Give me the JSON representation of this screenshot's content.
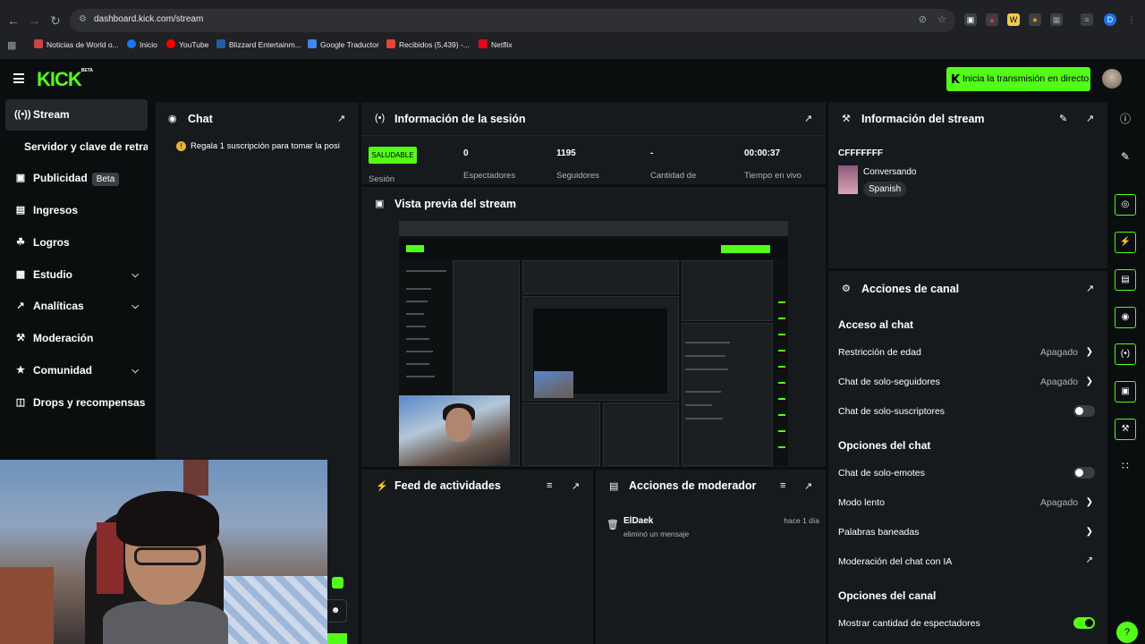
{
  "browser": {
    "url": "dashboard.kick.com/stream",
    "bookmarks": [
      "Noticias de World o...",
      "Inicio",
      "YouTube",
      "Blizzard Entertainm...",
      "Google Traductor",
      "Recibidos (5,439) -...",
      "Netflix"
    ],
    "profile_initial": "D"
  },
  "header": {
    "logo": "KICK",
    "logo_badge": "BETA",
    "golive_label": "Inicia la transmisión en directo"
  },
  "sidebar": {
    "items": [
      {
        "label": "Stream"
      },
      {
        "label": "Servidor y clave de retransmisión"
      },
      {
        "label": "Publicidad",
        "badge": "Beta"
      },
      {
        "label": "Ingresos"
      },
      {
        "label": "Logros"
      },
      {
        "label": "Estudio"
      },
      {
        "label": "Analíticas"
      },
      {
        "label": "Moderación"
      },
      {
        "label": "Comunidad"
      },
      {
        "label": "Drops y recompensas"
      }
    ]
  },
  "chat": {
    "title": "Chat",
    "pinned": "Regala 1 suscripción para tomar la posi"
  },
  "session": {
    "title": "Información de la sesión",
    "health": "SALUDABLE",
    "health_label": "Sesión",
    "stats": [
      {
        "value": "0",
        "label": "Espectadores"
      },
      {
        "value": "1195",
        "label": "Seguidores"
      },
      {
        "value": "-",
        "label": "Cantidad de"
      },
      {
        "value": "00:00:37",
        "label": "Tiempo en vivo"
      }
    ]
  },
  "preview": {
    "title": "Vista previa del stream"
  },
  "activity": {
    "title": "Feed de actividades"
  },
  "modactions": {
    "title": "Acciones de moderador",
    "entry": {
      "user": "ElDaek",
      "action": "eliminó un mensaje",
      "time": "hace 1 día"
    }
  },
  "streaminfo": {
    "title": "Información del stream",
    "stream_title": "CFFFFFFF",
    "category": "Conversando",
    "language": "Spanish"
  },
  "channel": {
    "title": "Acciones de canal",
    "sections": [
      {
        "title": "Acceso al chat",
        "rows": [
          {
            "label": "Restricción de edad",
            "value": "Apagado",
            "kind": "chevron"
          },
          {
            "label": "Chat de solo-seguidores",
            "value": "Apagado",
            "kind": "chevron"
          },
          {
            "label": "Chat de solo-suscriptores",
            "kind": "toggle",
            "on": false
          }
        ]
      },
      {
        "title": "Opciones del chat",
        "rows": [
          {
            "label": "Chat de solo-emotes",
            "kind": "toggle",
            "on": false
          },
          {
            "label": "Modo lento",
            "value": "Apagado",
            "kind": "chevron"
          },
          {
            "label": "Palabras baneadas",
            "kind": "chevron"
          },
          {
            "label": "Moderación del chat con IA",
            "kind": "external"
          }
        ]
      },
      {
        "title": "Opciones del canal",
        "rows": [
          {
            "label": "Mostrar cantidad de espectadores",
            "kind": "toggle",
            "on": true
          }
        ]
      }
    ]
  },
  "colors": {
    "accent": "#53fc18",
    "bg": "#0b0e0f",
    "panel": "#171a1c"
  }
}
